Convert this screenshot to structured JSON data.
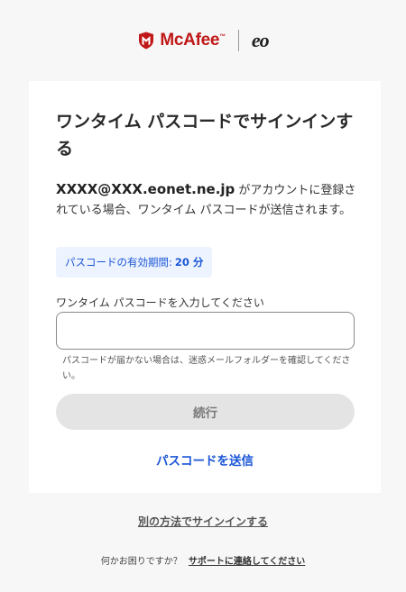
{
  "header": {
    "brand_name": "McAfee",
    "brand_tm": "™",
    "partner_logo": "eo",
    "brand_color": "#c01818"
  },
  "card": {
    "title": "ワンタイム パスコードでサインインする",
    "email": "XXXX@XXX.eonet.ne.jp",
    "description": " がアカウントに登録されている場合、ワンタイム パスコードが送信されます。",
    "validity_label": "パスコードの有効期間:",
    "validity_value": "20 分",
    "input_label": "ワンタイム パスコードを入力してください",
    "input_value": "",
    "hint": "パスコードが届かない場合は、迷惑メールフォルダーを確認してください。",
    "continue_label": "続行",
    "resend_label": "パスコードを送信",
    "accent_color": "#1a56d6"
  },
  "footer": {
    "alt_signin_label": "別の方法でサインインする",
    "help_text": "何かお困りですか？",
    "support_link": "サポートに連絡してください"
  }
}
